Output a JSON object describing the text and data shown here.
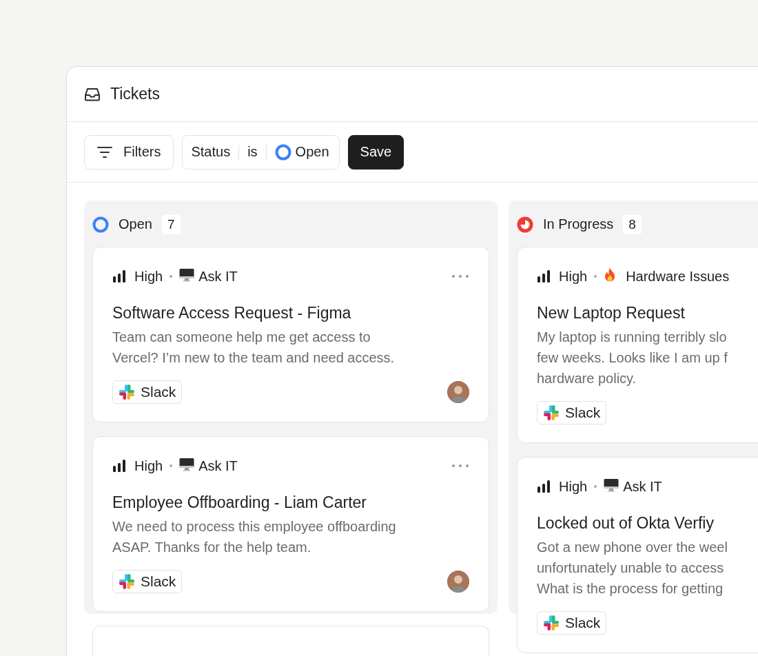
{
  "window": {
    "title": "Tickets"
  },
  "toolbar": {
    "filters_button": "Filters",
    "filter_chip": {
      "field": "Status",
      "operator": "is",
      "value": {
        "label": "Open",
        "kind": "open"
      }
    },
    "save_button": "Save"
  },
  "columns": [
    {
      "title": "Open",
      "kind": "open",
      "count": "7",
      "cards": [
        {
          "kind": "ticket",
          "priority": {
            "label": "High",
            "kind": "high"
          },
          "category": {
            "label": "Ask IT",
            "kind": "monitor"
          },
          "title": "Software Access Request - Figma",
          "description": [
            "Team can someone help me get access to",
            "Vercel? I’m new to the team and need access."
          ],
          "source": "Slack",
          "menu": true,
          "avatar": true
        },
        {
          "kind": "ticket",
          "priority": {
            "label": "High",
            "kind": "high"
          },
          "category": {
            "label": "Ask IT",
            "kind": "monitor"
          },
          "title": "Employee Offboarding - Liam Carter",
          "description": [
            "We need to process this employee offboarding",
            "ASAP. Thanks for the help team."
          ],
          "source": "Slack",
          "menu": true,
          "avatar": true
        },
        {
          "kind": "cutoff"
        }
      ]
    },
    {
      "title": "In Progress",
      "kind": "progress",
      "count": "8",
      "cards": [
        {
          "kind": "ticket",
          "priority": {
            "label": "High",
            "kind": "high"
          },
          "category": {
            "label": "Hardware Issues",
            "kind": "fire"
          },
          "title": "New Laptop Request",
          "description": [
            "My laptop is running terribly slo",
            "few weeks. Looks like I am up f",
            "hardware policy."
          ],
          "source": "Slack"
        },
        {
          "kind": "ticket",
          "priority": {
            "label": "High",
            "kind": "high"
          },
          "category": {
            "label": "Ask IT",
            "kind": "monitor"
          },
          "title": "Locked out of Okta Verfiy",
          "description": [
            "Got a new phone over the weel",
            "unfortunately unable to access",
            "What is the process for getting"
          ],
          "source": "Slack"
        }
      ]
    }
  ]
}
